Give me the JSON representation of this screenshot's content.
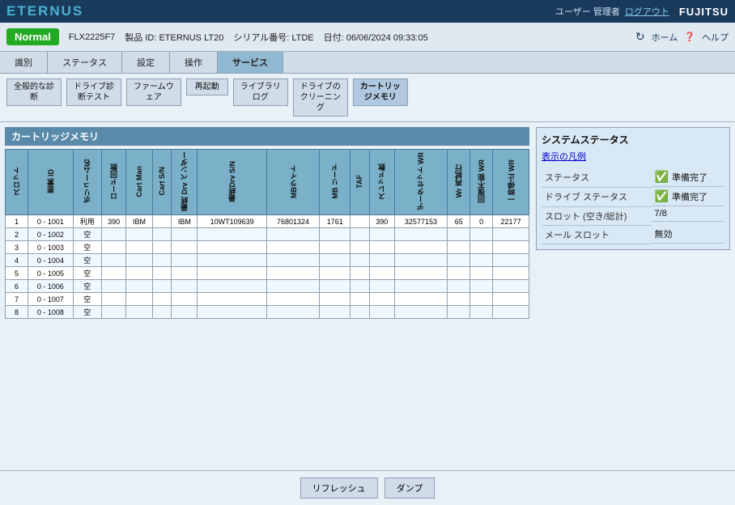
{
  "header": {
    "logo": "ETERNUS",
    "user_label": "ユーザー 管理者",
    "logout_label": "ログアウト",
    "brand": "FUJITSU"
  },
  "topbar": {
    "status_badge": "Normal",
    "model": "FLX2225F7",
    "product_id_label": "製品 ID: ETERNUS LT20",
    "serial_label": "シリアル番号: LTDE",
    "date_label": "日付: 06/06/2024 09:33:05",
    "home_label": "ホーム",
    "help_label": "ヘルプ"
  },
  "navtabs": [
    {
      "label": "識別",
      "active": false
    },
    {
      "label": "ステータス",
      "active": false
    },
    {
      "label": "設定",
      "active": false
    },
    {
      "label": "操作",
      "active": false
    },
    {
      "label": "サービス",
      "active": true
    }
  ],
  "subtoolbar": {
    "buttons": [
      {
        "label": "全般的な診断",
        "id": "btn-general-diag"
      },
      {
        "label": "ドライブ診断テスト",
        "id": "btn-drive-diag"
      },
      {
        "label": "ファームウェア",
        "id": "btn-firmware"
      },
      {
        "label": "再起動",
        "id": "btn-restart"
      },
      {
        "label": "ライブラリ ログ",
        "id": "btn-library-log"
      },
      {
        "label": "ドライブの クリーニング",
        "id": "btn-drive-clean"
      },
      {
        "label": "カートリッジメモリ",
        "id": "btn-cartridge-mem"
      }
    ]
  },
  "cartridge_section": {
    "title": "カートリッジメモリ",
    "columns": [
      {
        "id": "slot",
        "label": "スロット"
      },
      {
        "id": "elem_id",
        "label": "要素 ID"
      },
      {
        "id": "volume_name",
        "label": "ボリューム名"
      },
      {
        "id": "load_count",
        "label": "ロード回数"
      },
      {
        "id": "cart_man",
        "label": "Cart Man"
      },
      {
        "id": "cart_sn",
        "label": "Cart S/N"
      },
      {
        "id": "last_drv_vendor",
        "label": "最終 Drv ベンダー"
      },
      {
        "id": "last_drv_sn",
        "label": "最終Drv S/N"
      },
      {
        "id": "mb_write",
        "label": "MBライト"
      },
      {
        "id": "mb_load",
        "label": "MB リード"
      },
      {
        "id": "taf",
        "label": "TAF"
      },
      {
        "id": "sled_count",
        "label": "スレッド数"
      },
      {
        "id": "dataset_wr",
        "label": "データセット WR"
      },
      {
        "id": "wr_retry",
        "label": "Wr 再試行"
      },
      {
        "id": "irrecov_wr",
        "label": "回復不能 WR"
      },
      {
        "id": "temp_stop_wr",
        "label": "一時停止 WR"
      }
    ],
    "rows": [
      {
        "slot": "1",
        "elem_id": "0 - 1001",
        "volume_name": "利用",
        "load_count": "390",
        "cart_man": "IBM",
        "cart_sn": "",
        "last_drv_vendor": "IBM",
        "last_drv_sn": "10WT109639",
        "mb_write": "76801324",
        "mb_load": "1761",
        "taf": "",
        "sled_count": "390",
        "dataset_wr": "32577153",
        "wr_retry": "65",
        "irrecov_wr": "0",
        "temp_stop_wr": "22177"
      },
      {
        "slot": "2",
        "elem_id": "0 - 1002",
        "volume_name": "空",
        "load_count": "",
        "cart_man": "",
        "cart_sn": "",
        "last_drv_vendor": "",
        "last_drv_sn": "",
        "mb_write": "",
        "mb_load": "",
        "taf": "",
        "sled_count": "",
        "dataset_wr": "",
        "wr_retry": "",
        "irrecov_wr": "",
        "temp_stop_wr": ""
      },
      {
        "slot": "3",
        "elem_id": "0 - 1003",
        "volume_name": "空",
        "load_count": "",
        "cart_man": "",
        "cart_sn": "",
        "last_drv_vendor": "",
        "last_drv_sn": "",
        "mb_write": "",
        "mb_load": "",
        "taf": "",
        "sled_count": "",
        "dataset_wr": "",
        "wr_retry": "",
        "irrecov_wr": "",
        "temp_stop_wr": ""
      },
      {
        "slot": "4",
        "elem_id": "0 - 1004",
        "volume_name": "空",
        "load_count": "",
        "cart_man": "",
        "cart_sn": "",
        "last_drv_vendor": "",
        "last_drv_sn": "",
        "mb_write": "",
        "mb_load": "",
        "taf": "",
        "sled_count": "",
        "dataset_wr": "",
        "wr_retry": "",
        "irrecov_wr": "",
        "temp_stop_wr": ""
      },
      {
        "slot": "5",
        "elem_id": "0 - 1005",
        "volume_name": "空",
        "load_count": "",
        "cart_man": "",
        "cart_sn": "",
        "last_drv_vendor": "",
        "last_drv_sn": "",
        "mb_write": "",
        "mb_load": "",
        "taf": "",
        "sled_count": "",
        "dataset_wr": "",
        "wr_retry": "",
        "irrecov_wr": "",
        "temp_stop_wr": ""
      },
      {
        "slot": "6",
        "elem_id": "0 - 1006",
        "volume_name": "空",
        "load_count": "",
        "cart_man": "",
        "cart_sn": "",
        "last_drv_vendor": "",
        "last_drv_sn": "",
        "mb_write": "",
        "mb_load": "",
        "taf": "",
        "sled_count": "",
        "dataset_wr": "",
        "wr_retry": "",
        "irrecov_wr": "",
        "temp_stop_wr": ""
      },
      {
        "slot": "7",
        "elem_id": "0 - 1007",
        "volume_name": "空",
        "load_count": "",
        "cart_man": "",
        "cart_sn": "",
        "last_drv_vendor": "",
        "last_drv_sn": "",
        "mb_write": "",
        "mb_load": "",
        "taf": "",
        "sled_count": "",
        "dataset_wr": "",
        "wr_retry": "",
        "irrecov_wr": "",
        "temp_stop_wr": ""
      },
      {
        "slot": "8",
        "elem_id": "0 - 1008",
        "volume_name": "空",
        "load_count": "",
        "cart_man": "",
        "cart_sn": "",
        "last_drv_vendor": "",
        "last_drv_sn": "",
        "mb_write": "",
        "mb_load": "",
        "taf": "",
        "sled_count": "",
        "dataset_wr": "",
        "wr_retry": "",
        "irrecov_wr": "",
        "temp_stop_wr": ""
      }
    ]
  },
  "system_status": {
    "title": "システムステータス",
    "legend_label": "表示の凡例",
    "rows": [
      {
        "label": "ステータス",
        "value": "準備完了",
        "ok": true
      },
      {
        "label": "ドライブ ステータス",
        "value": "準備完了",
        "ok": true
      },
      {
        "label": "スロット (空き/総計)",
        "value": "7/8",
        "ok": false
      },
      {
        "label": "メール スロット",
        "value": "無効",
        "ok": false
      }
    ]
  },
  "bottom": {
    "refresh_label": "リフレッシュ",
    "dump_label": "ダンプ"
  }
}
